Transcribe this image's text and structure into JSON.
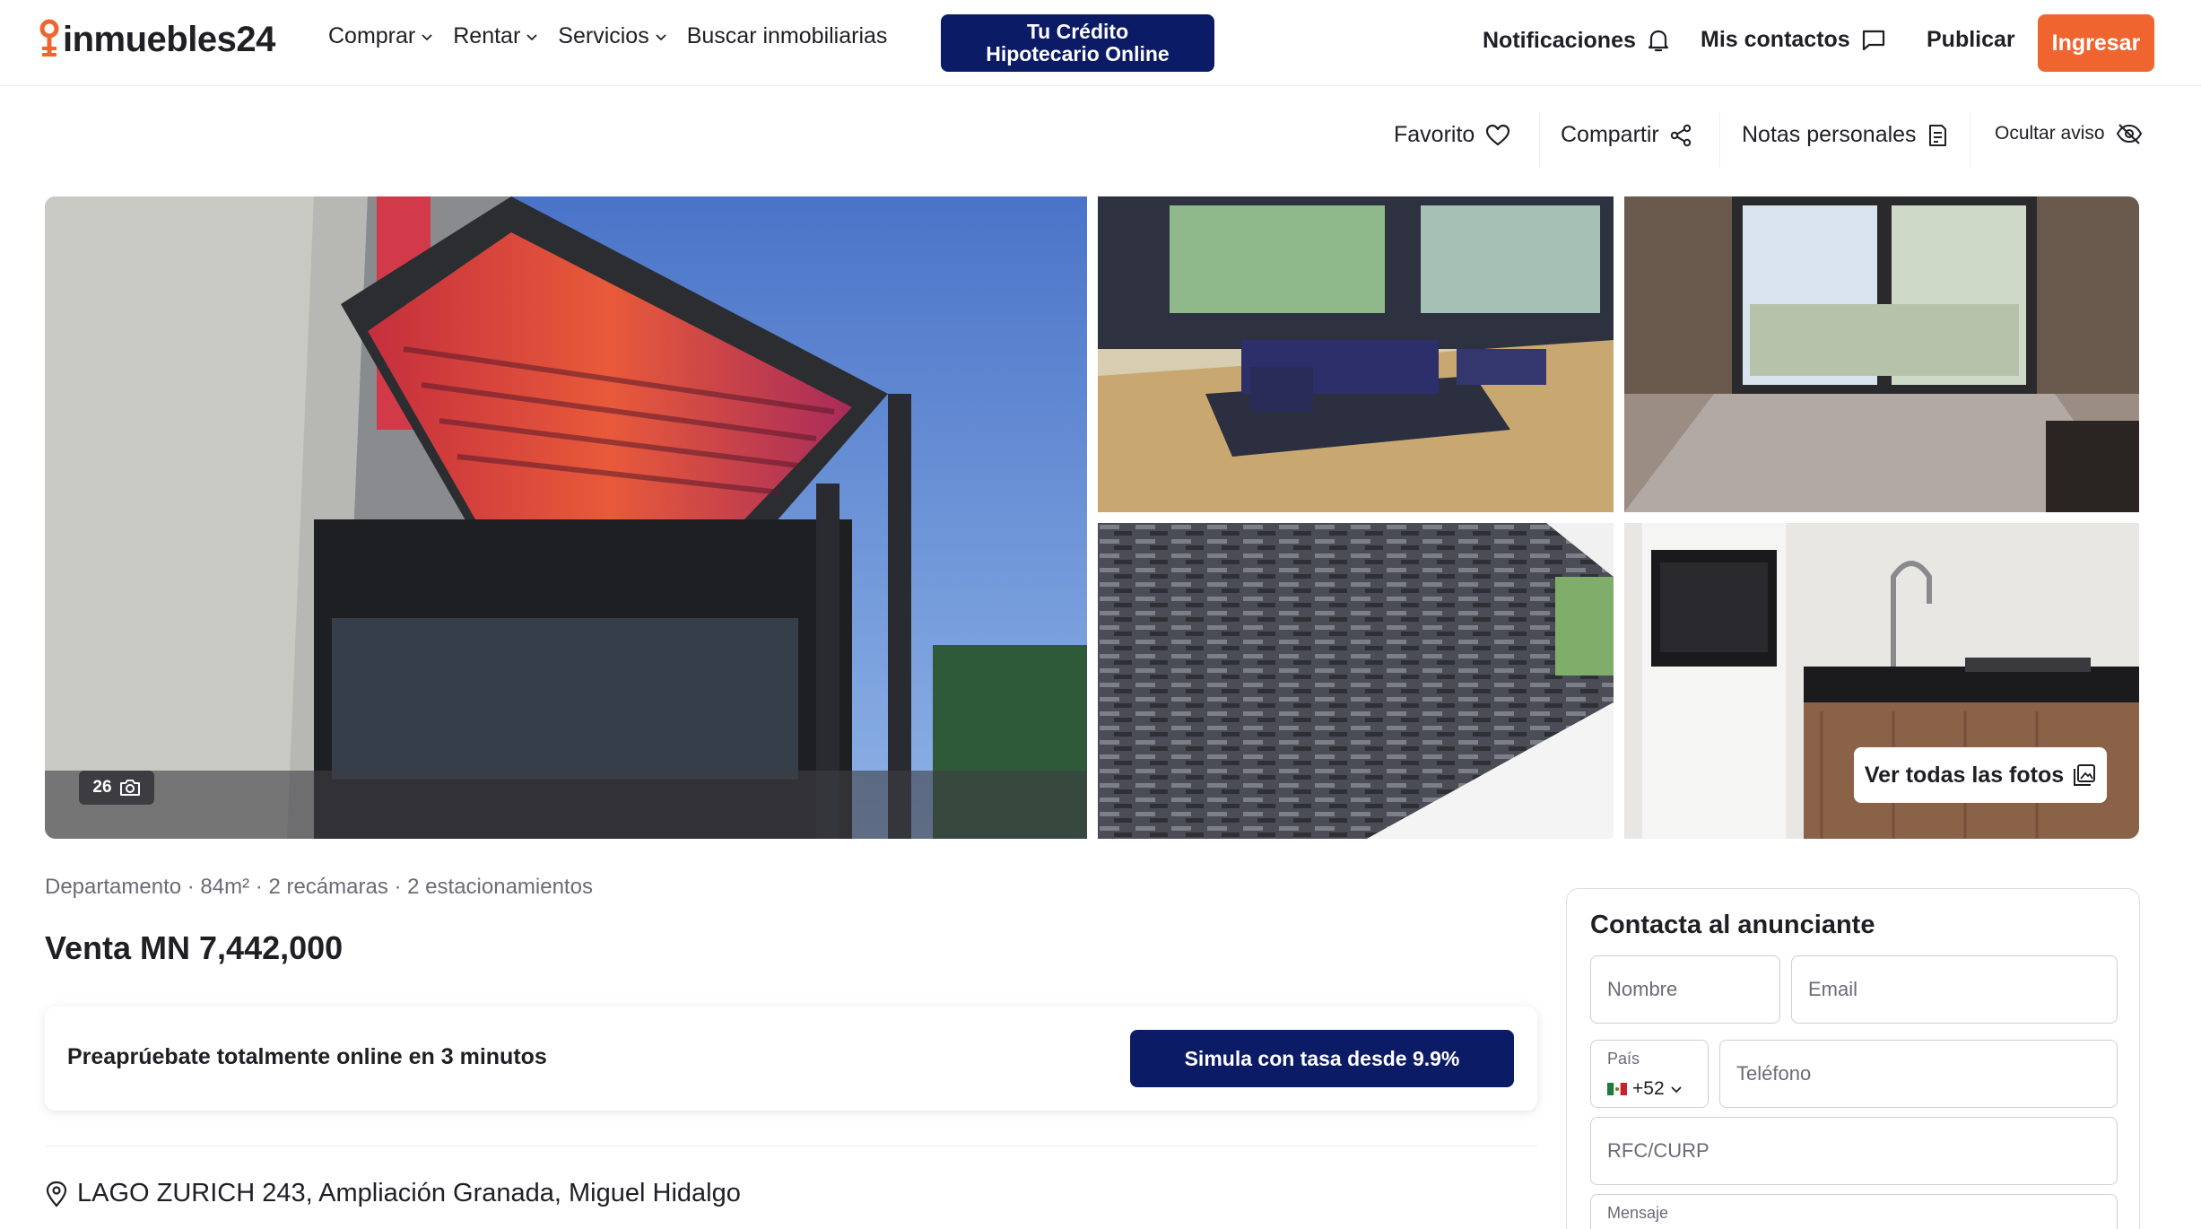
{
  "header": {
    "logo_text": "inmuebles24",
    "nav": [
      {
        "label": "Comprar",
        "has_dropdown": true
      },
      {
        "label": "Rentar",
        "has_dropdown": true
      },
      {
        "label": "Servicios",
        "has_dropdown": true
      },
      {
        "label": "Buscar inmobiliarias",
        "has_dropdown": false
      }
    ],
    "credit_button": {
      "line1": "Tu Crédito",
      "line2": "Hipotecario Online"
    },
    "notifications_label": "Notificaciones",
    "contacts_label": "Mis contactos",
    "publish_label": "Publicar",
    "login_label": "Ingresar"
  },
  "actions": {
    "favorite": "Favorito",
    "share": "Compartir",
    "notes": "Notas personales",
    "hide": "Ocultar aviso"
  },
  "gallery": {
    "photo_count": "26",
    "view_all": "Ver todas las fotos"
  },
  "listing": {
    "features": {
      "type": "Departamento",
      "area": "84m²",
      "bedrooms": "2 recámaras",
      "parking": "2 estacionamientos",
      "sep": " · "
    },
    "price": "Venta MN 7,442,000",
    "preapproval": {
      "text": "Preaprúebate totalmente online en 3 minutos",
      "button": "Simula con tasa desde 9.9%"
    },
    "address": "LAGO ZURICH 243, Ampliación Granada, Miguel Hidalgo"
  },
  "contact": {
    "title": "Contacta al anunciante",
    "name_placeholder": "Nombre",
    "email_placeholder": "Email",
    "country_label": "País",
    "country_code": "+52",
    "phone_placeholder": "Teléfono",
    "rfc_placeholder": "RFC/CURP",
    "message_label": "Mensaje"
  },
  "colors": {
    "brand_orange": "#f0652f",
    "navy": "#0b1b66",
    "text": "#1f1f24",
    "muted": "#6b6b78"
  }
}
